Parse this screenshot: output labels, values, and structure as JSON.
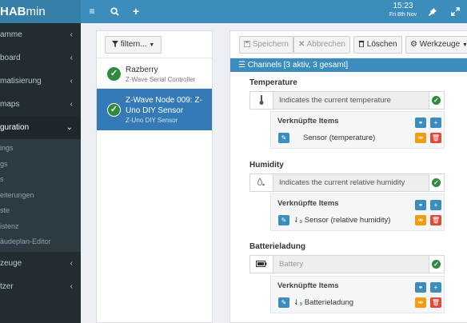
{
  "app": {
    "logo_prefix": "",
    "logo_bold": "HAB",
    "logo_rest": "min"
  },
  "sidebar": {
    "items": [
      {
        "label": "amme"
      },
      {
        "label": "board"
      },
      {
        "label": "matisierung"
      },
      {
        "label": "maps"
      },
      {
        "label": "guration"
      }
    ],
    "subitems": [
      {
        "label": "ings"
      },
      {
        "label": "gs"
      },
      {
        "label": "s"
      },
      {
        "label": "eiterungen"
      },
      {
        "label": "ste"
      },
      {
        "label": "istenz"
      },
      {
        "label": "äudeplan-Editor"
      }
    ],
    "bottom_items": [
      {
        "label": "zeuge"
      },
      {
        "label": "tzer"
      }
    ]
  },
  "topbar": {
    "time": "15:23",
    "date": "Fri 8th Nov"
  },
  "filter": {
    "label": "filtern..."
  },
  "devices": [
    {
      "name": "Razberry",
      "type": "Z-Wave Serial Controller"
    },
    {
      "name": "Z-Wave Node 009: Z-Uno DIY Sensor",
      "type": "Z-Uno DIY Sensor"
    }
  ],
  "toolbar": {
    "save": "Speichern",
    "cancel": "Abbrechen",
    "delete": "Löschen",
    "tools": "Werkzeuge"
  },
  "channels": {
    "header": "Channels [3 aktiv, 3 gesamt]",
    "linked_label": "Verknüpfte Items",
    "list": [
      {
        "title": "Temperature",
        "description": "Indicates the current temperature",
        "item": "Sensor (temperature)",
        "icon": "thermometer-icon"
      },
      {
        "title": "Humidity",
        "description": "Indicates the current relative humidity",
        "item": "Sensor (relative humidity)",
        "icon": "humidity-icon"
      },
      {
        "title": "Batterieladung",
        "description": "Battery",
        "item": "Batterieladung",
        "icon": "battery-icon"
      }
    ]
  }
}
